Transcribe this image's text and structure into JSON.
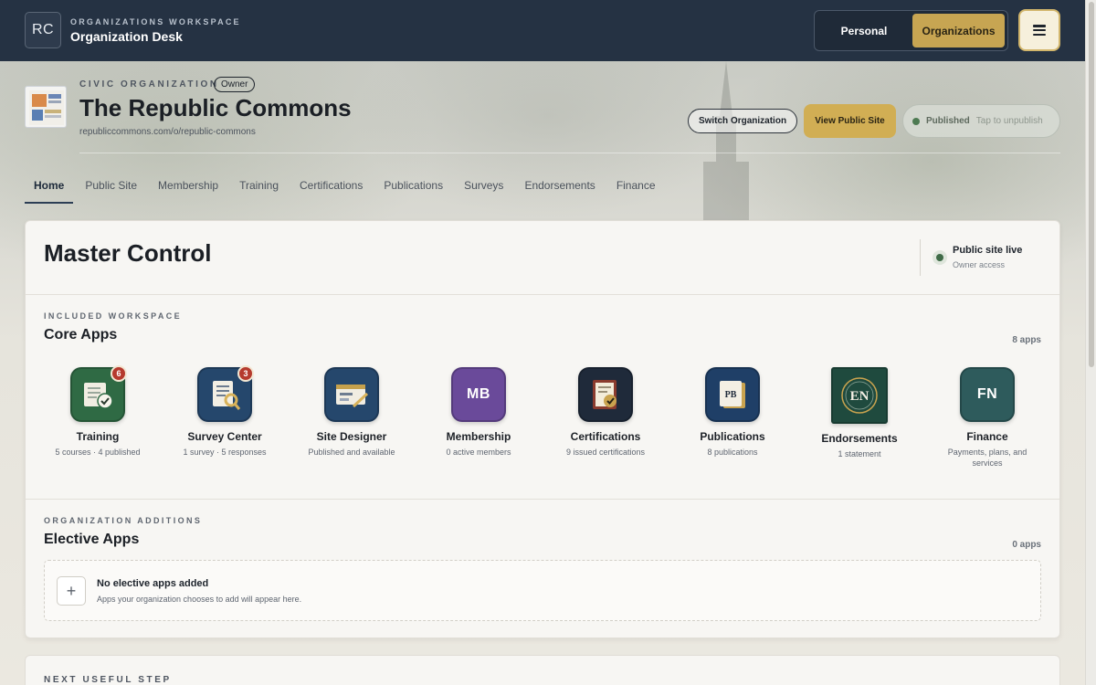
{
  "topbar": {
    "logo_initials": "RC",
    "eyebrow": "ORGANIZATIONS WORKSPACE",
    "title": "Organization Desk",
    "switcher": {
      "personal": "Personal",
      "organizations": "Organizations"
    },
    "menu_icon": "hamburger-icon"
  },
  "org": {
    "eyebrow": "CIVIC ORGANIZATION",
    "role_badge": "Owner",
    "name": "The Republic Commons",
    "url": "republiccommons.com/o/republic-commons",
    "switch_label": "Switch Organization",
    "view_label": "View Public Site",
    "publish_status": "Published",
    "publish_hint": "Tap to unpublish"
  },
  "tabs": [
    "Home",
    "Public Site",
    "Membership",
    "Training",
    "Certifications",
    "Publications",
    "Surveys",
    "Endorsements",
    "Finance"
  ],
  "main": {
    "title": "Master Control",
    "live_title": "Public site live",
    "live_sub": "Owner access",
    "core": {
      "eyebrow": "INCLUDED WORKSPACE",
      "title": "Core Apps",
      "count": "8 apps",
      "apps": [
        {
          "name": "Training",
          "sub": "5 courses · 4 published",
          "badge": "6",
          "icon": "training-icon",
          "color": "#2f6a44"
        },
        {
          "name": "Survey Center",
          "sub": "1 survey · 5 responses",
          "badge": "3",
          "icon": "survey-icon",
          "color": "#25476c"
        },
        {
          "name": "Site Designer",
          "sub": "Published and available",
          "icon": "site-designer-icon",
          "color": "#25476c"
        },
        {
          "name": "Membership",
          "sub": "0 active members",
          "mono": "MB",
          "icon": "membership-icon",
          "color": "#6a4a9a"
        },
        {
          "name": "Certifications",
          "sub": "9 issued certifications",
          "icon": "certificate-icon",
          "color": "#1f2a3a"
        },
        {
          "name": "Publications",
          "sub": "8 publications",
          "icon": "publications-icon",
          "color": "#1f3f67"
        },
        {
          "name": "Endorsements",
          "sub": "1 statement",
          "mono": "EN",
          "icon": "endorsements-icon",
          "color": "#1f4a3e"
        },
        {
          "name": "Finance",
          "sub": "Payments, plans, and services",
          "mono": "FN",
          "icon": "finance-icon",
          "color": "#2e5b5c"
        }
      ]
    },
    "elective": {
      "eyebrow": "ORGANIZATION ADDITIONS",
      "title": "Elective Apps",
      "count": "0 apps",
      "empty_title": "No elective apps added",
      "empty_sub": "Apps your organization chooses to add will appear here.",
      "add_symbol": "+"
    }
  },
  "next": {
    "eyebrow": "NEXT USEFUL STEP"
  }
}
